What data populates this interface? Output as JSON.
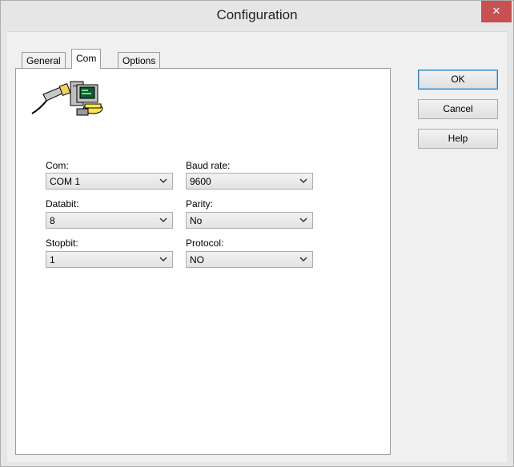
{
  "window": {
    "title": "Configuration",
    "close_glyph": "✕"
  },
  "tabs": [
    {
      "label": "General",
      "active": false
    },
    {
      "label": "Com",
      "active": true
    },
    {
      "label": "Options",
      "active": false
    }
  ],
  "icon": "serial-connection-computer-icon",
  "fields": {
    "com": {
      "label": "Com:",
      "value": "COM 1"
    },
    "baud_rate": {
      "label": "Baud rate:",
      "value": "9600"
    },
    "databit": {
      "label": "Databit:",
      "value": "8"
    },
    "parity": {
      "label": "Parity:",
      "value": "No"
    },
    "stopbit": {
      "label": "Stopbit:",
      "value": "1"
    },
    "protocol": {
      "label": "Protocol:",
      "value": "NO"
    }
  },
  "buttons": {
    "ok": "OK",
    "cancel": "Cancel",
    "help": "Help"
  },
  "colors": {
    "close_button": "#c75050",
    "client_bg": "#f0f0f0",
    "panel_bg": "#ffffff"
  }
}
